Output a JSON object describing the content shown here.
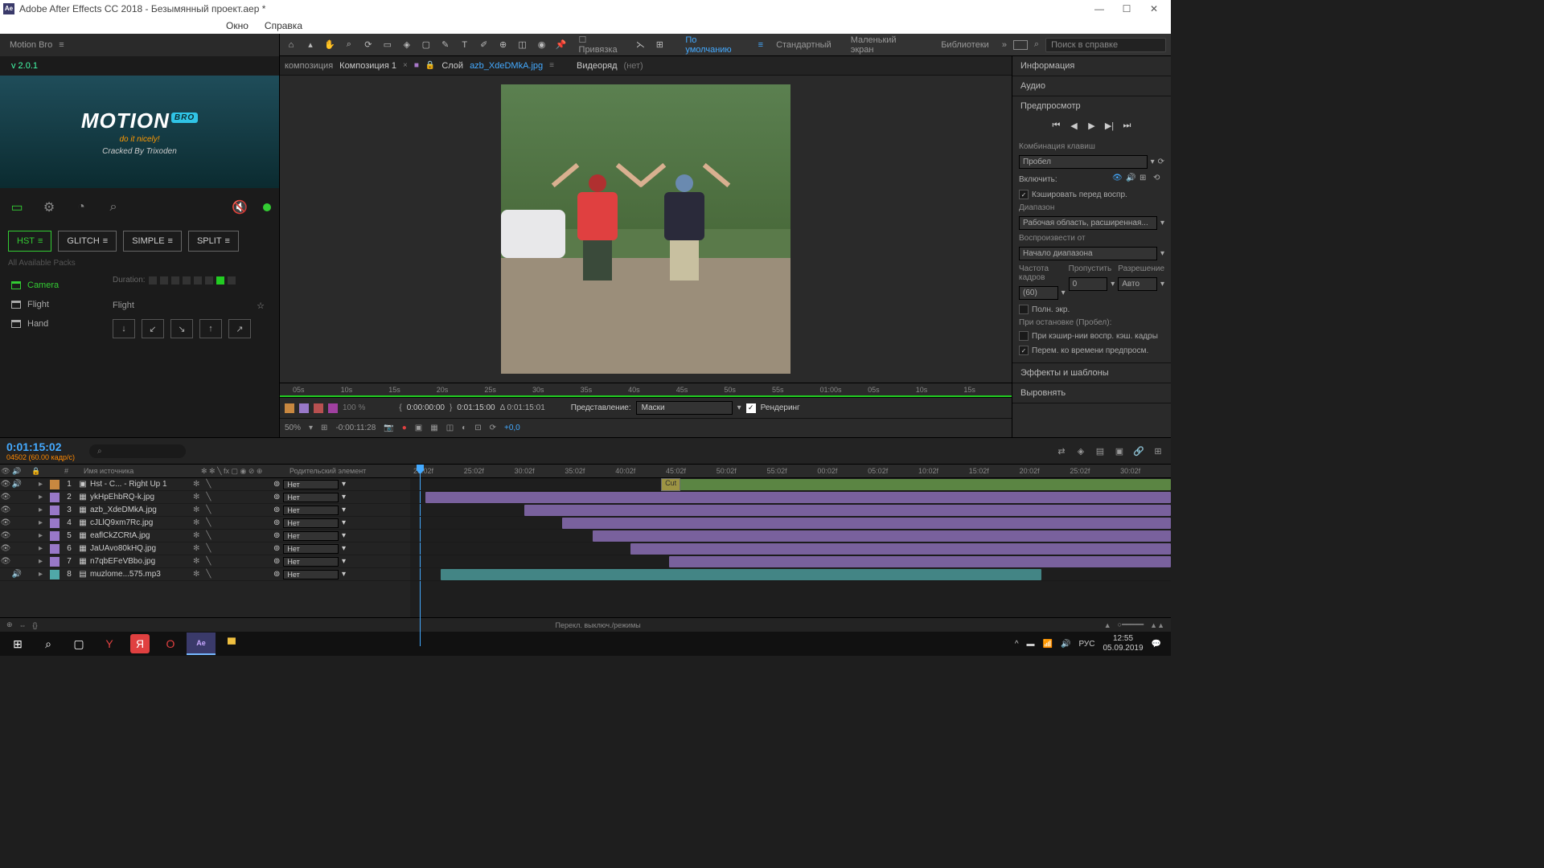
{
  "titlebar": {
    "icon": "Ae",
    "title": "Adobe After Effects CC 2018 - Безымянный проект.aep *"
  },
  "menubar": {
    "items": [
      "Окно",
      "Справка"
    ]
  },
  "toolrow": {
    "snap": "Привязка",
    "workspaces": [
      "По умолчанию",
      "Стандартный",
      "Маленький экран",
      "Библиотеки"
    ],
    "search_placeholder": "Поиск в справке"
  },
  "motionbro": {
    "header": "Motion Bro",
    "version": "v 2.0.1",
    "logo_main": "MOTION",
    "logo_badge": "BRO",
    "logo_tag": "do it nicely!",
    "logo_crack": "Cracked By Trixoden",
    "tabs": [
      "HST",
      "GLITCH",
      "SIMPLE",
      "SPLIT"
    ],
    "sub": "All Available Packs",
    "tree": [
      "Camera",
      "Flight",
      "Hand"
    ],
    "duration_label": "Duration:",
    "flight_label": "Flight"
  },
  "comp_tabs": {
    "left": "композиция",
    "active": "Композиция 1",
    "layer_prefix": "Слой",
    "layer_name": "azb_XdeDMkA.jpg",
    "video_label": "Видеоряд",
    "video_val": "(нет)"
  },
  "time_ruler": [
    "05s",
    "10s",
    "15s",
    "20s",
    "25s",
    "30s",
    "35s",
    "40s",
    "45s",
    "50s",
    "55s",
    "01:00s",
    "05s",
    "10s",
    "15s"
  ],
  "comp_ctrl": {
    "start": "0:00:00:00",
    "end": "0:01:15:00",
    "delta": "Δ 0:01:15:01",
    "mode_label": "Представление:",
    "mode_val": "Маски",
    "render": "Рендеринг",
    "zoom": "50%",
    "current": "-0:00:11:28",
    "plus": "+0,0"
  },
  "rightpanel": {
    "info": "Информация",
    "audio": "Аудио",
    "preview": "Предпросмотр",
    "shortcut_label": "Комбинация клавиш",
    "shortcut_val": "Пробел",
    "enable": "Включить:",
    "cache": "Кэшировать перед воспр.",
    "range_label": "Диапазон",
    "range_val": "Рабочая область, расширенная...",
    "playfrom_label": "Воспроизвести от",
    "playfrom_val": "Начало диапазона",
    "freq_label": "Частота кадров",
    "skip_label": "Пропустить",
    "res_label": "Разрешение",
    "freq_val": "(60)",
    "skip_val": "0",
    "res_val": "Авто",
    "fullscreen": "Полн. экр.",
    "onstop": "При остановке (Пробел):",
    "onstop1": "При кэшир-нии воспр. кэш. кадры",
    "onstop2": "Перем. ко времени предпросм.",
    "effects": "Эффекты и шаблоны",
    "align": "Выровнять"
  },
  "timeline": {
    "timecode": "0:01:15:02",
    "sub": "04502 (60.00 кадр/с)",
    "search": "⌕",
    "col_num": "#",
    "col_name": "Имя источника",
    "col_parent": "Родительский элемент",
    "ruler": [
      "20:02f",
      "25:02f",
      "30:02f",
      "35:02f",
      "40:02f",
      "45:02f",
      "50:02f",
      "55:02f",
      "00:02f",
      "05:02f",
      "10:02f",
      "15:02f",
      "20:02f",
      "25:02f",
      "30:02f"
    ],
    "cut_label": "Cut",
    "layers": [
      {
        "n": "1",
        "name": "Hst - C... - Right Up 1",
        "icon": "▣",
        "color": "c-orange",
        "parent": "Нет",
        "bar_left": "10%",
        "bar_right": "100%",
        "bar_color": "c-green"
      },
      {
        "n": "2",
        "name": "ykHpEhbRQ-k.jpg",
        "icon": "▦",
        "color": "c-purple",
        "parent": "Нет",
        "bar_left": "2%",
        "bar_right": "100%",
        "bar_color": "c-purple"
      },
      {
        "n": "3",
        "name": "azb_XdeDMkA.jpg",
        "icon": "▦",
        "color": "c-purple",
        "parent": "Нет",
        "bar_left": "15%",
        "bar_right": "100%",
        "bar_color": "c-purple"
      },
      {
        "n": "4",
        "name": "cJLlQ9xm7Rc.jpg",
        "icon": "▦",
        "color": "c-purple",
        "parent": "Нет",
        "bar_left": "20%",
        "bar_right": "100%",
        "bar_color": "c-purple"
      },
      {
        "n": "5",
        "name": "eaflCkZCRtA.jpg",
        "icon": "▦",
        "color": "c-purple",
        "parent": "Нет",
        "bar_left": "24%",
        "bar_right": "100%",
        "bar_color": "c-purple"
      },
      {
        "n": "6",
        "name": "JaUAvo80kHQ.jpg",
        "icon": "▦",
        "color": "c-purple",
        "parent": "Нет",
        "bar_left": "29%",
        "bar_right": "100%",
        "bar_color": "c-purple"
      },
      {
        "n": "7",
        "name": "n7qbEFeVBbo.jpg",
        "icon": "▦",
        "color": "c-purple",
        "parent": "Нет",
        "bar_left": "34%",
        "bar_right": "100%",
        "bar_color": "c-purple"
      },
      {
        "n": "8",
        "name": "muzlome...575.mp3",
        "icon": "▤",
        "color": "c-teal",
        "parent": "Нет",
        "bar_left": "4%",
        "bar_right": "83%",
        "bar_color": "c-teal"
      }
    ],
    "footer": "Перекл. выключ./режимы"
  },
  "taskbar": {
    "lang": "РУС",
    "time": "12:55",
    "date": "05.09.2019"
  }
}
